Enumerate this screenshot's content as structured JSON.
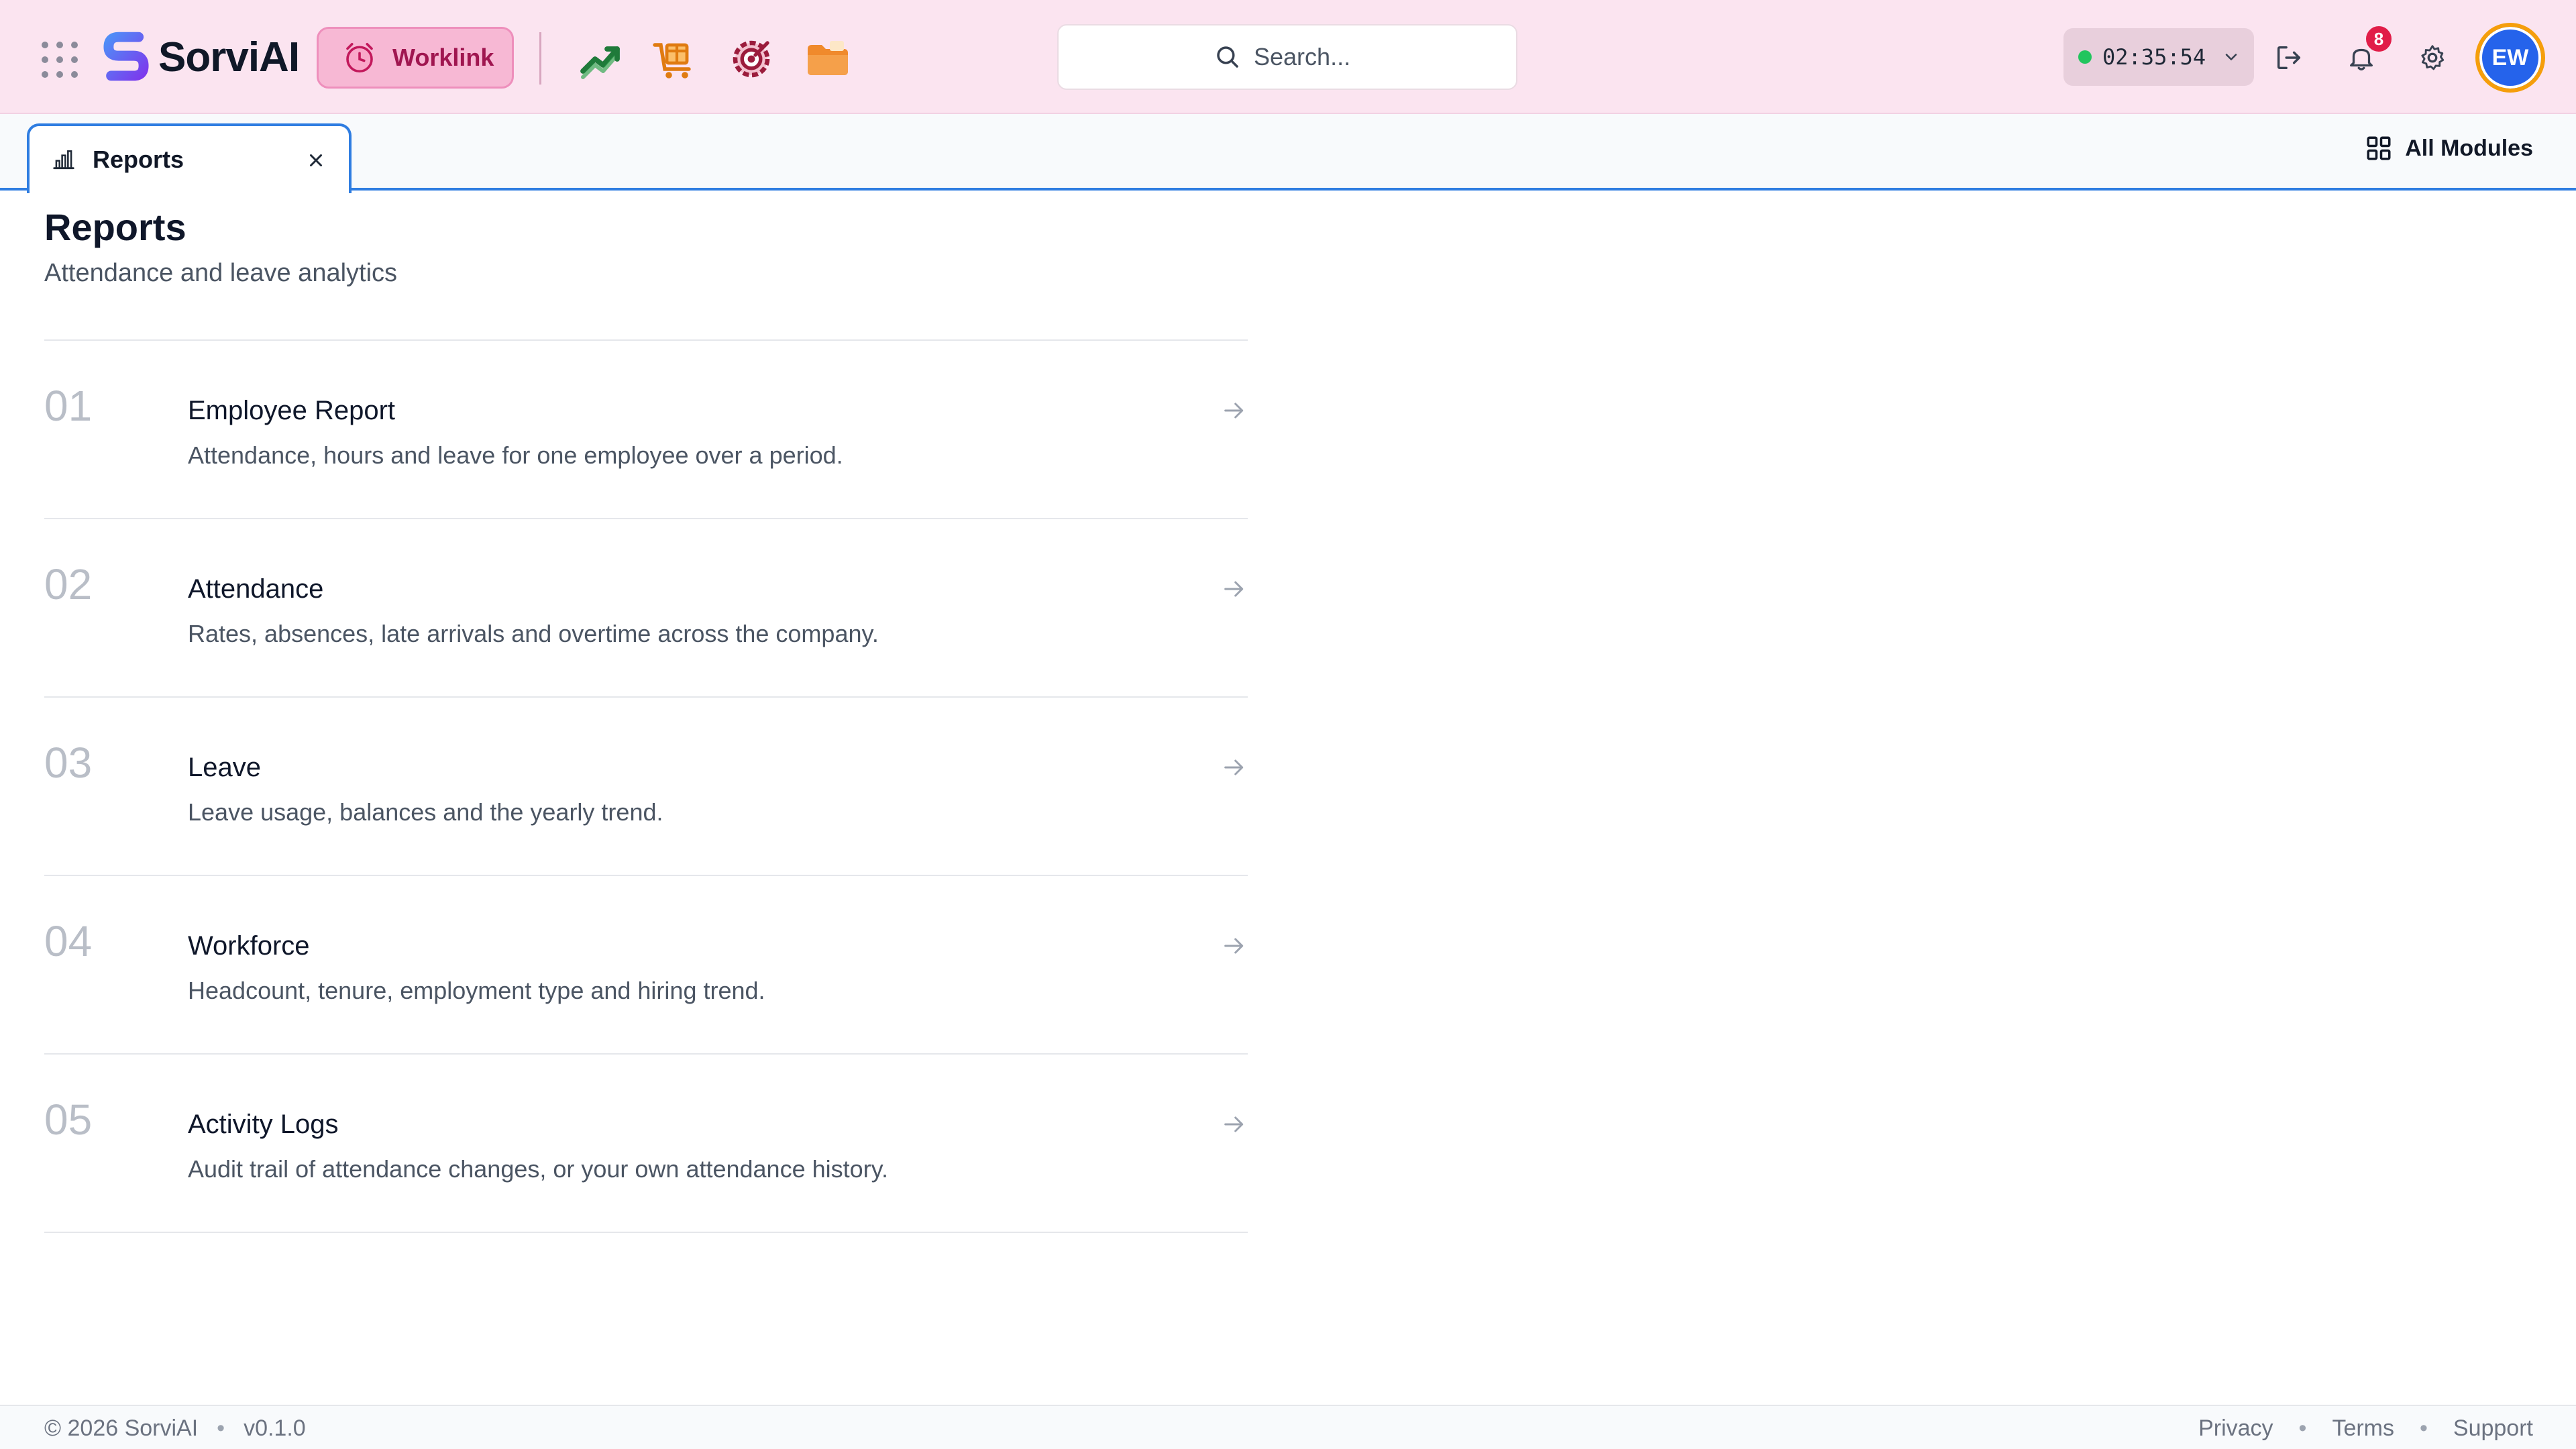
{
  "header": {
    "brand": "SorviAI",
    "active_module": "Worklink",
    "module_icons": [
      "trending-up-icon",
      "package-cart-icon",
      "gear-target-icon",
      "folder-icon"
    ],
    "search_placeholder": "Search...",
    "timer": {
      "status": "active",
      "time": "02:35:54"
    },
    "notifications_count": "8",
    "avatar_initials": "EW",
    "colors": {
      "header_bg": "#fbe4f0",
      "accent_pink": "#f7b8d4",
      "tab_blue": "#2f7de1",
      "avatar_blue": "#2563eb",
      "avatar_ring": "#f59e0b"
    }
  },
  "tabs": [
    {
      "label": "Reports",
      "icon": "bar-chart-icon",
      "active": true
    }
  ],
  "all_modules_label": "All Modules",
  "page": {
    "title": "Reports",
    "subtitle": "Attendance and leave analytics"
  },
  "reports": [
    {
      "num": "01",
      "title": "Employee Report",
      "desc": "Attendance, hours and leave for one employee over a period."
    },
    {
      "num": "02",
      "title": "Attendance",
      "desc": "Rates, absences, late arrivals and overtime across the company."
    },
    {
      "num": "03",
      "title": "Leave",
      "desc": "Leave usage, balances and the yearly trend."
    },
    {
      "num": "04",
      "title": "Workforce",
      "desc": "Headcount, tenure, employment type and hiring trend."
    },
    {
      "num": "05",
      "title": "Activity Logs",
      "desc": "Audit trail of attendance changes, or your own attendance history."
    }
  ],
  "footer": {
    "copyright": "© 2026 SorviAI",
    "version": "v0.1.0",
    "links": [
      "Privacy",
      "Terms",
      "Support"
    ]
  }
}
